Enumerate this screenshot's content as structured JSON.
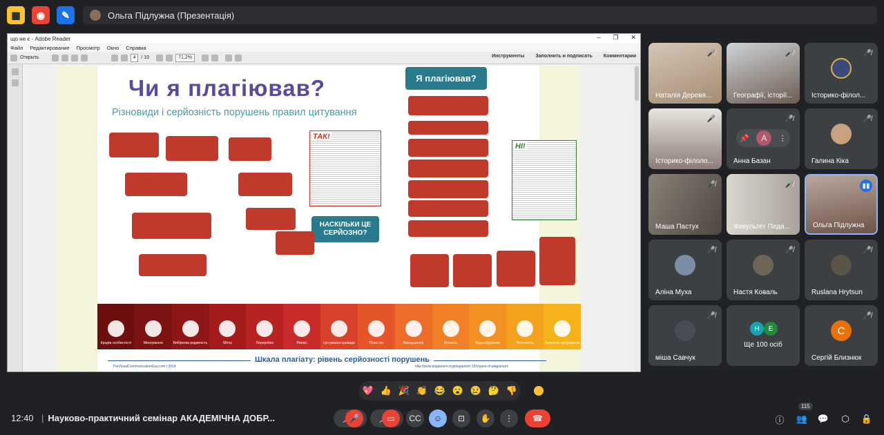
{
  "topbar": {
    "presenter": "Ольга Підлужна (Презентація)",
    "app_icons": [
      "activities-icon",
      "record-icon",
      "whiteboard-icon"
    ]
  },
  "adobe": {
    "window_title": "що не є - Adobe Reader",
    "menu": [
      "Файл",
      "Редактирование",
      "Просмотр",
      "Окно",
      "Справка"
    ],
    "open_label": "Открыть",
    "page_current": "4",
    "page_total": "/ 10",
    "zoom": "71,2%",
    "toolbar_right": [
      "Инструменты",
      "Заполнить и подписать",
      "Комментарии"
    ]
  },
  "slide": {
    "title": "Чи я плагіював?",
    "subtitle": "Різновиди і серйозність порушень правил цитування",
    "callout_top": "Я плагіював?",
    "callout_mid": "НАСКІЛЬКИ ЦЕ СЕРЙОЗНО?",
    "label_yes": "ТАК!",
    "label_no": "НІ!",
    "scale_title": "Шкала плагіату: рівень серйозності порушень",
    "source_left": "TheVisualCommunicationGuy.com | 2014",
    "source_right": "http://www.plagiarism.org/plagiarism-101/types-of-plagiarism/",
    "strip": [
      {
        "label": "Крадіж особистості",
        "color": "#6d0f0f"
      },
      {
        "label": "Маскування",
        "color": "#7d1212"
      },
      {
        "label": "Вибіркова родинність",
        "color": "#8e1616"
      },
      {
        "label": "Мітоз",
        "color": "#a31b1b"
      },
      {
        "label": "Переробка",
        "color": "#b72222"
      },
      {
        "label": "Ремікс",
        "color": "#c92a2a"
      },
      {
        "label": "Цитування привида",
        "color": "#d8412a"
      },
      {
        "label": "Пізнє пів",
        "color": "#e4562a"
      },
      {
        "label": "Вивершення",
        "color": "#ed6c2a"
      },
      {
        "label": "Мозаїка",
        "color": "#f07f26"
      },
      {
        "label": "Відшліфування",
        "color": "#f29022"
      },
      {
        "label": "Неточність",
        "color": "#f4a11e"
      },
      {
        "label": "Латентне цитуванням",
        "color": "#f6b21a"
      }
    ]
  },
  "participants": [
    {
      "name": "Наталія Деревя...",
      "kind": "video"
    },
    {
      "name": "Географії, історії...",
      "kind": "video"
    },
    {
      "name": "Історико-філол...",
      "kind": "emblem"
    },
    {
      "name": "Історико-філоло...",
      "kind": "video"
    },
    {
      "name": "Анна Базан",
      "kind": "avatar",
      "initial": "А",
      "color": "#b05a6b"
    },
    {
      "name": "Галина Кіка",
      "kind": "photo"
    },
    {
      "name": "Маша Пастух",
      "kind": "video"
    },
    {
      "name": "Факультет Педа...",
      "kind": "video"
    },
    {
      "name": "Ольга Підлужна",
      "kind": "video"
    },
    {
      "name": "Аліна Муха",
      "kind": "photo"
    },
    {
      "name": "Настя Коваль",
      "kind": "photo"
    },
    {
      "name": "Ruslana Hrytsun",
      "kind": "photo"
    },
    {
      "name": "міша Савчук",
      "kind": "photo"
    },
    {
      "name": "Ще 100 осіб",
      "kind": "more",
      "initials": [
        "Н",
        "Е"
      ]
    },
    {
      "name": "Сергій Близнюк",
      "kind": "avatar",
      "initial": "С",
      "color": "#e8710a"
    }
  ],
  "reactions": [
    "💖",
    "👍",
    "🎉",
    "👏",
    "😂",
    "😮",
    "😢",
    "🤔",
    "👎"
  ],
  "bottombar": {
    "time": "12:40",
    "meeting_title": "Науково-практичний семінар АКАДЕМІЧНА ДОБР...",
    "participants_count": "115"
  },
  "colors": {
    "meet_bg": "#202124",
    "tile_bg": "#3c4043",
    "end_call": "#ea4335",
    "slide_title": "#5b4a9b",
    "callout": "#2a7a8d"
  }
}
